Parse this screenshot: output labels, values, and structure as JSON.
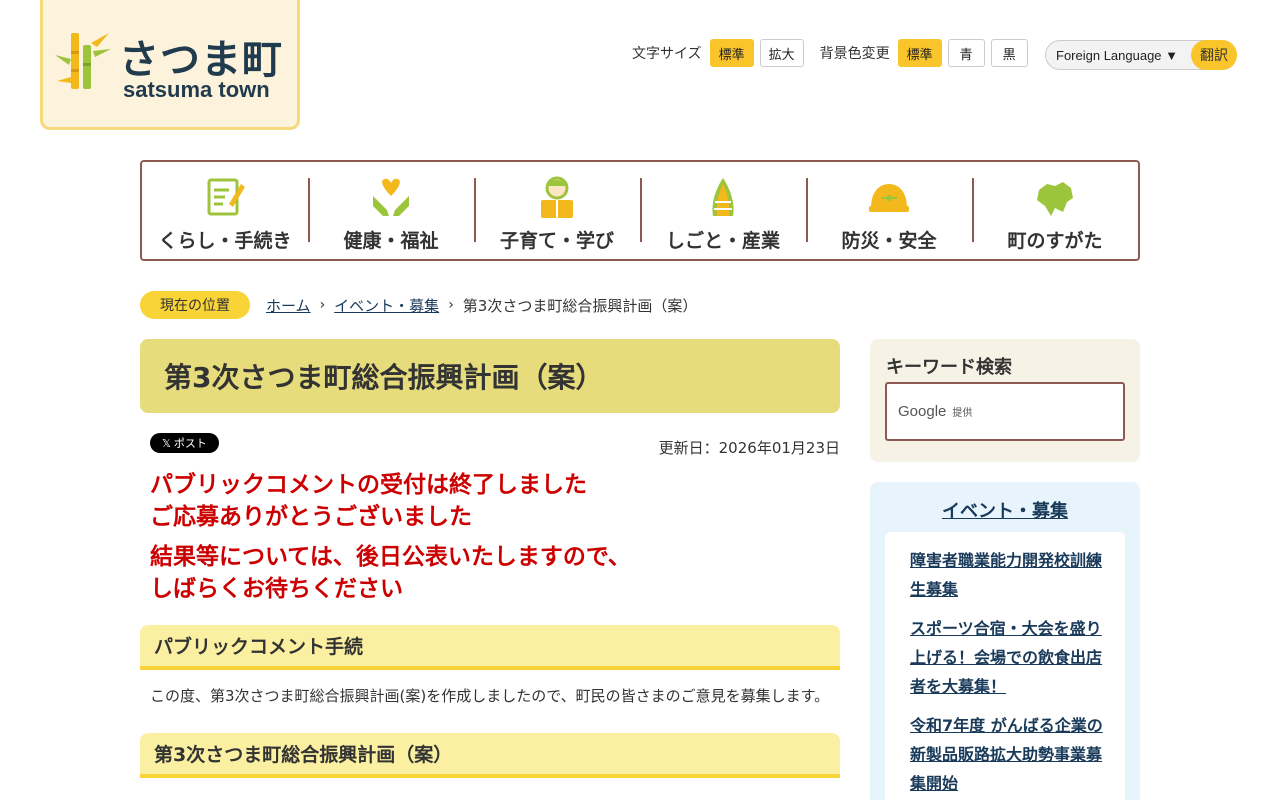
{
  "logo": {
    "jp": "さつま町",
    "en": "satsuma town"
  },
  "tools": {
    "font_size_label": "文字サイズ",
    "font_size_options": [
      "標準",
      "拡大"
    ],
    "bg_label": "背景色変更",
    "bg_options": [
      "標準",
      "青",
      "黒"
    ],
    "language_select": "Foreign Language",
    "translate_button": "翻訳"
  },
  "gnav": [
    {
      "label": "くらし・手続き",
      "icon": "form-pen-icon"
    },
    {
      "label": "健康・福祉",
      "icon": "hands-heart-icon"
    },
    {
      "label": "子育て・学び",
      "icon": "child-book-icon"
    },
    {
      "label": "しごと・産業",
      "icon": "bamboo-shoot-icon"
    },
    {
      "label": "防災・安全",
      "icon": "helmet-icon"
    },
    {
      "label": "町のすがた",
      "icon": "town-map-icon"
    }
  ],
  "breadcrumb": {
    "tag": "現在の位置",
    "items": [
      "ホーム",
      "イベント・募集",
      "第3次さつま町総合振興計画（案）"
    ]
  },
  "page": {
    "title": "第3次さつま町総合振興計画（案）",
    "x_post": "𝕏 ポスト",
    "updated": "更新日：2026年01月23日",
    "alert_1": [
      "パブリックコメントの受付は終了しました",
      "ご応募ありがとうございました"
    ],
    "alert_2": [
      "結果等については、後日公表いたしますので、",
      "しばらくお待ちください"
    ],
    "section_1_title": "パブリックコメント手続",
    "section_1_text": "この度、第3次さつま町総合振興計画(案)を作成しましたので、町民の皆さまのご意見を募集します。",
    "section_2_title": "第3次さつま町総合振興計画（案）"
  },
  "side": {
    "search_title": "キーワード検索",
    "search_google": "Google",
    "search_provided": "提供",
    "event_title": "イベント・募集",
    "events": [
      "障害者職業能力開発校訓練生募集",
      "スポーツ合宿・大会を盛り上げる！会場での飲食出店者を大募集！",
      "令和7年度 がんばる企業の新製品販路拡大助勢事業募集開始"
    ]
  },
  "colors": {
    "accent": "#f9c52a",
    "title_bg": "#e6dc7c",
    "alert": "#cc0000",
    "nav_border": "#8c5a50"
  }
}
